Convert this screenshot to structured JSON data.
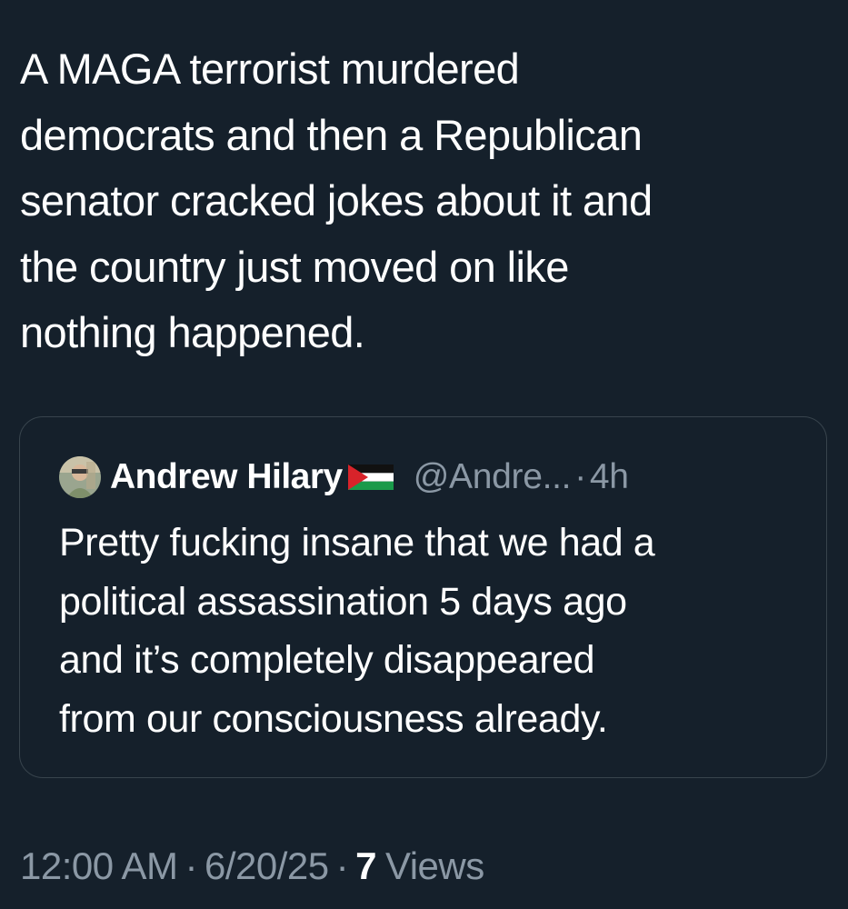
{
  "tweet": {
    "text_lines": [
      "A MAGA terrorist murdered",
      "democrats and then a Republican",
      "senator cracked jokes about it and",
      "the country just moved on like",
      "nothing happened."
    ]
  },
  "quote": {
    "author_name": "Andrew Hilary",
    "author_flag": "palestine-flag-icon",
    "handle": "@Andre...",
    "separator": "·",
    "time_ago": "4h",
    "text_lines": [
      "Pretty fucking insane that we had a",
      "political assassination 5 days ago",
      "and it’s completely disappeared",
      "from our consciousness already."
    ]
  },
  "meta": {
    "time": "12:00 AM",
    "separator": "·",
    "date": "6/20/25",
    "views_count": "7",
    "views_label": "Views"
  },
  "colors": {
    "background": "#15202b",
    "text_primary": "#ffffff",
    "text_secondary": "#8b98a5",
    "card_border": "#38444d"
  }
}
